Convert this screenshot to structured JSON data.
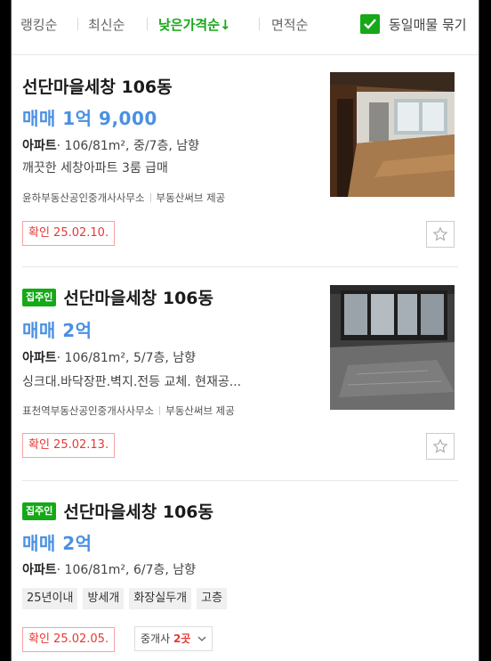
{
  "sort": {
    "items": [
      "랭킹순",
      "최신순",
      "낮은가격순↓",
      "면적순"
    ],
    "same_listing_label": "동일매물 묶기"
  },
  "listings": [
    {
      "badge": "",
      "title": "선단마을세창 106동",
      "price": "매매 1억 9,000",
      "type": "아파트",
      "spec": "· 106/81m², 중/7층, 남향",
      "desc": "깨끗한 세창아파트 3룸 급매",
      "agent": "윤하부동산공인중개사사무소",
      "provider": "부동산써브 제공",
      "confirmed": "확인 25.02.10."
    },
    {
      "badge": "집주인",
      "title": "선단마을세창 106동",
      "price": "매매 2억",
      "type": "아파트",
      "spec": "· 106/81m², 5/7층, 남향",
      "desc": "싱크대.바닥장판.벽지.전등 교체. 현재공...",
      "agent": "표천역부동산공인중개사사무소",
      "provider": "부동산써브 제공",
      "confirmed": "확인 25.02.13."
    },
    {
      "badge": "집주인",
      "title": "선단마을세창 106동",
      "price": "매매 2억",
      "type": "아파트",
      "spec": "· 106/81m², 6/7층, 남향",
      "tags": [
        "25년이내",
        "방세개",
        "화장실두개",
        "고층"
      ],
      "confirmed": "확인 25.02.05.",
      "broker_label": "중개사",
      "broker_count": "2곳"
    }
  ],
  "colors": {
    "accent_green": "#16a818",
    "price_blue": "#4a90e2",
    "confirm_red": "#e53935"
  }
}
